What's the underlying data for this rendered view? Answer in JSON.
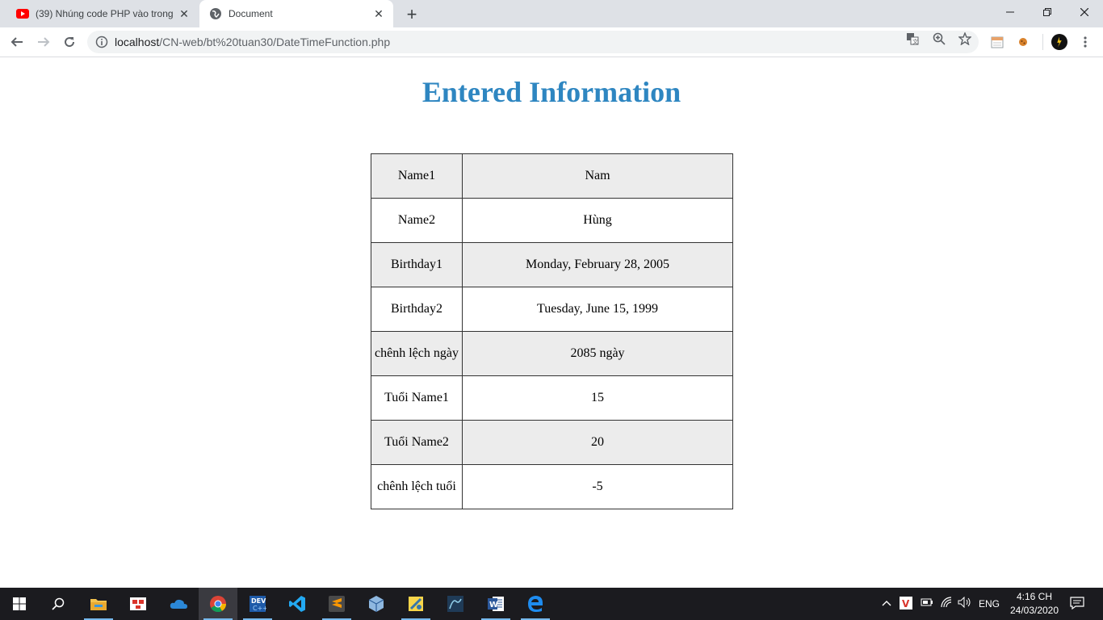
{
  "browser": {
    "tabs": [
      {
        "title": "(39) Nhúng code PHP vào trong HTML",
        "icon": "youtube-icon",
        "active": false
      },
      {
        "title": "Document",
        "icon": "globe-icon",
        "active": true
      }
    ],
    "address": {
      "host": "localhost",
      "path": "/CN-web/bt%20tuan30/DateTimeFunction.php"
    }
  },
  "page": {
    "heading": "Entered Information",
    "heading_color": "#2e86c1",
    "rows": [
      {
        "label": "Name1",
        "value": "Nam"
      },
      {
        "label": "Name2",
        "value": "Hùng"
      },
      {
        "label": "Birthday1",
        "value": "Monday, February 28, 2005"
      },
      {
        "label": "Birthday2",
        "value": "Tuesday, June 15, 1999"
      },
      {
        "label": "chênh lệch ngày",
        "value": "2085 ngày"
      },
      {
        "label": "Tuổi Name1",
        "value": "15"
      },
      {
        "label": "Tuổi Name2",
        "value": "20"
      },
      {
        "label": "chênh lệch tuổi",
        "value": "-5"
      }
    ]
  },
  "taskbar": {
    "apps": [
      "windows-start-icon",
      "search-icon",
      "file-explorer-icon",
      "snipping-tool-icon",
      "onedrive-icon",
      "chrome-icon",
      "dev-cpp-icon",
      "vscode-icon",
      "sublime-text-icon",
      "virtualbox-icon",
      "python-idle-icon",
      "mysql-workbench-icon",
      "word-icon",
      "edge-icon"
    ],
    "language": "ENG",
    "time": "4:16 CH",
    "date": "24/03/2020"
  }
}
